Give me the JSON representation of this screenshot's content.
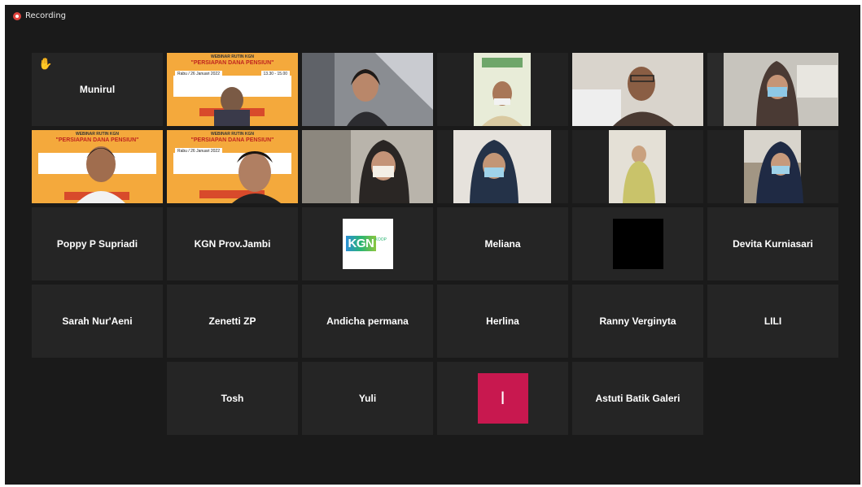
{
  "recording": {
    "label": "Recording"
  },
  "slide": {
    "header": "WEBINAR RUTIN KGN",
    "title": "\"PERSIAPAN DANA PENSIUN\"",
    "date": "Rabu / 26 Januari 2022",
    "time": "13.30 - 15.00"
  },
  "kgn_logo": {
    "text": "KGN",
    "sub": "KOOP"
  },
  "participants": {
    "munirul": "Munirul",
    "poppy": "Poppy P Supriadi",
    "kgn_jambi": "KGN Prov.Jambi",
    "meliana": "Meliana",
    "devita": "Devita Kurniasari",
    "sarah": "Sarah Nur'Aeni",
    "zenetti": "Zenetti ZP",
    "andicha": "Andicha permana",
    "herlina": "Herlina",
    "ranny": "Ranny Verginyta",
    "lili": "LILI",
    "tosh": "Tosh",
    "yuli": "Yuli",
    "astuti": "Astuti Batik Galeri"
  },
  "avatar_initial": "I",
  "colors": {
    "background": "#1a1a1a",
    "tile": "#252525",
    "active_speaker": "#d6e34f",
    "raise_hand": "#f5b83d",
    "avatar_initial": "#c8184f",
    "recording_dot": "#e0443e"
  }
}
